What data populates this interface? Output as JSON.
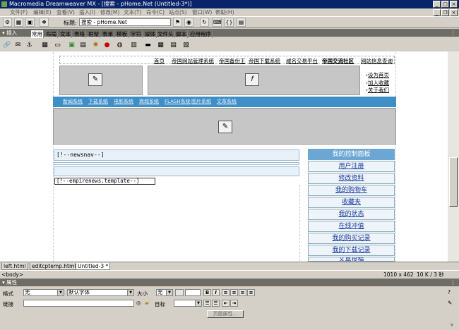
{
  "window": {
    "title": "Macromedia Dreamweaver MX - [搜索 - pHome.Net (Untitled-3*)]",
    "controls": [
      "_",
      "□",
      "×"
    ]
  },
  "menu": [
    "文件(F)",
    "编辑(E)",
    "查看(V)",
    "插入(I)",
    "修改(M)",
    "文本(T)",
    "命令(C)",
    "站点(S)",
    "窗口(W)",
    "帮助(H)"
  ],
  "toolbar": {
    "title_label": "标题:",
    "title_value": "搜索 - pHome.Net"
  },
  "insert_panel": {
    "header": "▾ 插入",
    "tabs": [
      "常用",
      "布局",
      "文本",
      "表格",
      "框架",
      "表单",
      "模板",
      "字符",
      "媒体",
      "文件头",
      "脚本",
      "应用程序"
    ],
    "active_tab": "常用"
  },
  "document": {
    "top_links": [
      "首页",
      "帝国网站管理系统",
      "帝国备份王",
      "帝国下载系统",
      "域名交易平台",
      "帝国交流社区",
      "网站信息查询"
    ],
    "side_links": [
      "设为首页",
      "加入收藏",
      "关于我们"
    ],
    "channel_links": [
      "新闻系统",
      "下载系统",
      "电影系统",
      "商城系统",
      "FLASH系统",
      "图片系统",
      "文章系统"
    ],
    "newsnav_tag": "[!--newsnav--]",
    "template_tag": "[!--empirenews.template--]",
    "control_panel": {
      "title": "我的控制面板",
      "items": [
        "用户注册",
        "修改资料",
        "我的购物车",
        "收藏夹",
        "我的状态",
        "在线冲值",
        "我的购买记录",
        "我的下载记录",
        "文章投稿"
      ]
    }
  },
  "doc_tabs": [
    "left.html",
    "editcptemp.html",
    "Untitled-3 *"
  ],
  "status": {
    "tag": "<body>",
    "size": "1010 x 462",
    "download": "10 K / 3 秒"
  },
  "properties": {
    "header": "▾ 属性",
    "format_label": "格式",
    "format_value": "无",
    "font_value": "默认字体",
    "size_label": "大小",
    "size_value": "无",
    "link_label": "链接",
    "link_value": "",
    "target_label": "目标",
    "target_value": "",
    "bold": "B",
    "italic": "I",
    "page_props_button": "页面属性..."
  }
}
